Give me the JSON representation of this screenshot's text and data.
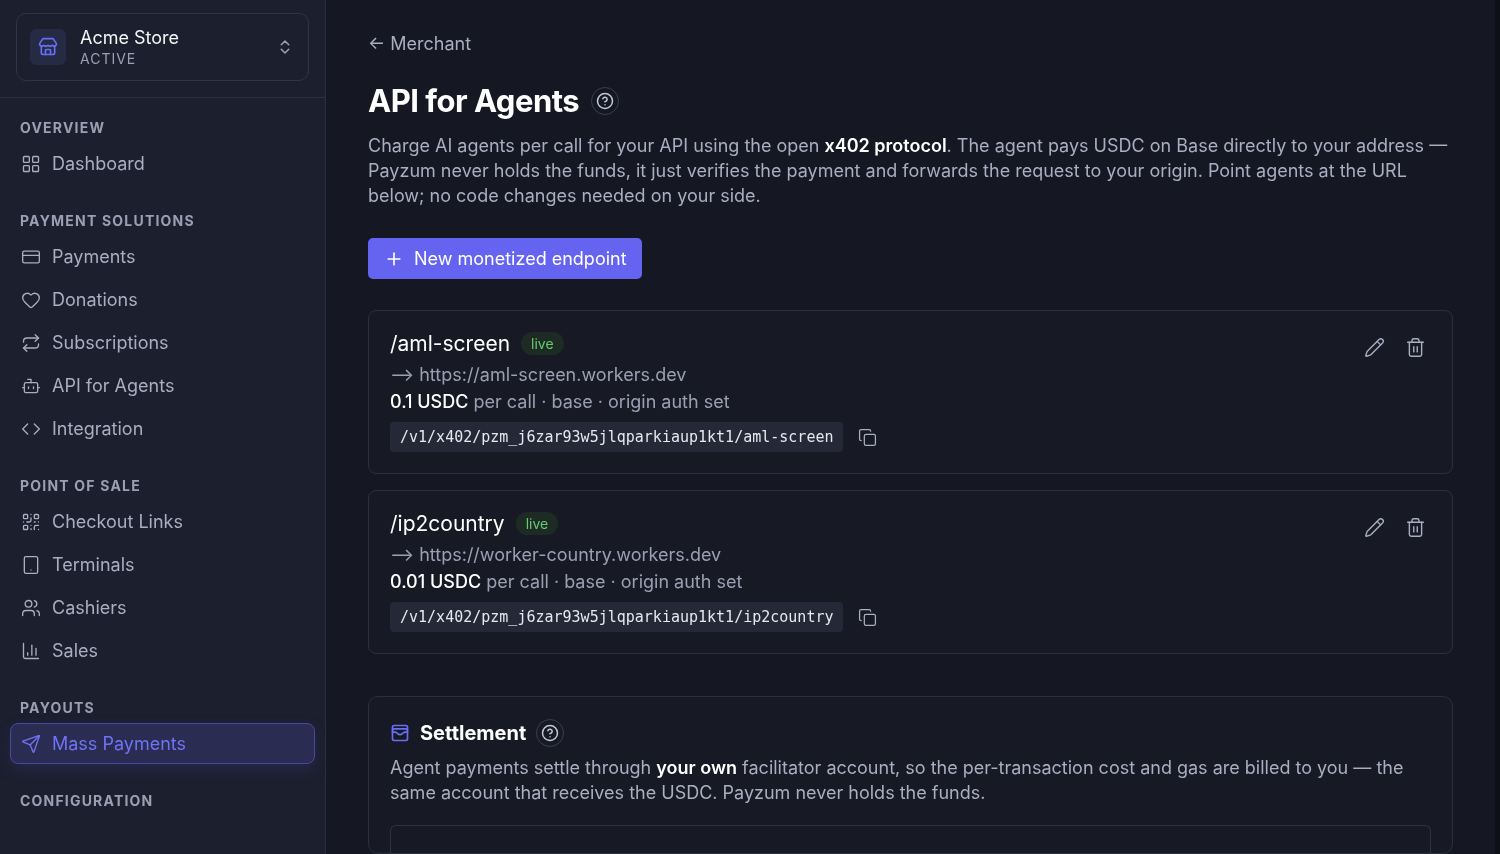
{
  "store": {
    "name": "Acme Store",
    "status": "ACTIVE"
  },
  "sidebar": {
    "sections": [
      {
        "heading": "OVERVIEW",
        "items": [
          {
            "label": "Dashboard",
            "selected": false
          }
        ]
      },
      {
        "heading": "PAYMENT SOLUTIONS",
        "items": [
          {
            "label": "Payments",
            "selected": false
          },
          {
            "label": "Donations",
            "selected": false
          },
          {
            "label": "Subscriptions",
            "selected": false
          },
          {
            "label": "API for Agents",
            "selected": false
          },
          {
            "label": "Integration",
            "selected": false
          }
        ]
      },
      {
        "heading": "POINT OF SALE",
        "items": [
          {
            "label": "Checkout Links",
            "selected": false
          },
          {
            "label": "Terminals",
            "selected": false
          },
          {
            "label": "Cashiers",
            "selected": false
          },
          {
            "label": "Sales",
            "selected": false
          }
        ]
      },
      {
        "heading": "PAYOUTS",
        "items": [
          {
            "label": "Mass Payments",
            "selected": true
          }
        ]
      },
      {
        "heading": "CONFIGURATION"
      }
    ]
  },
  "back_link": "← Merchant",
  "title": "API for Agents",
  "description": "Charge AI agents per call for your API using the open **x402 protocol**. The agent pays USDC on Base directly to your address — Payzum never holds the funds, it just verifies the payment and forwards the request to your origin. Point agents at the URL below; no code changes needed on your side.",
  "new_button": "New monetized endpoint",
  "endpoints": [
    {
      "path": "/aml-screen",
      "status": "live",
      "origin": "⟶ https://aml-screen.workers.dev",
      "price": "**0.1 USDC** per call · base · origin auth set",
      "url": "/v1/x402/pzm_j6zar93w5jlqparkiaup1kt1/aml-screen"
    },
    {
      "path": "/ip2country",
      "status": "live",
      "origin": "⟶ https://worker-country.workers.dev",
      "price": "**0.01 USDC** per call · base · origin auth set",
      "url": "/v1/x402/pzm_j6zar93w5jlqparkiaup1kt1/ip2country"
    }
  ],
  "settlement": {
    "title": "Settlement",
    "description": "Agent payments settle through **your own** facilitator account, so the per-transaction cost and gas are billed to you — the same account that receives the USDC. Payzum never holds the funds."
  }
}
